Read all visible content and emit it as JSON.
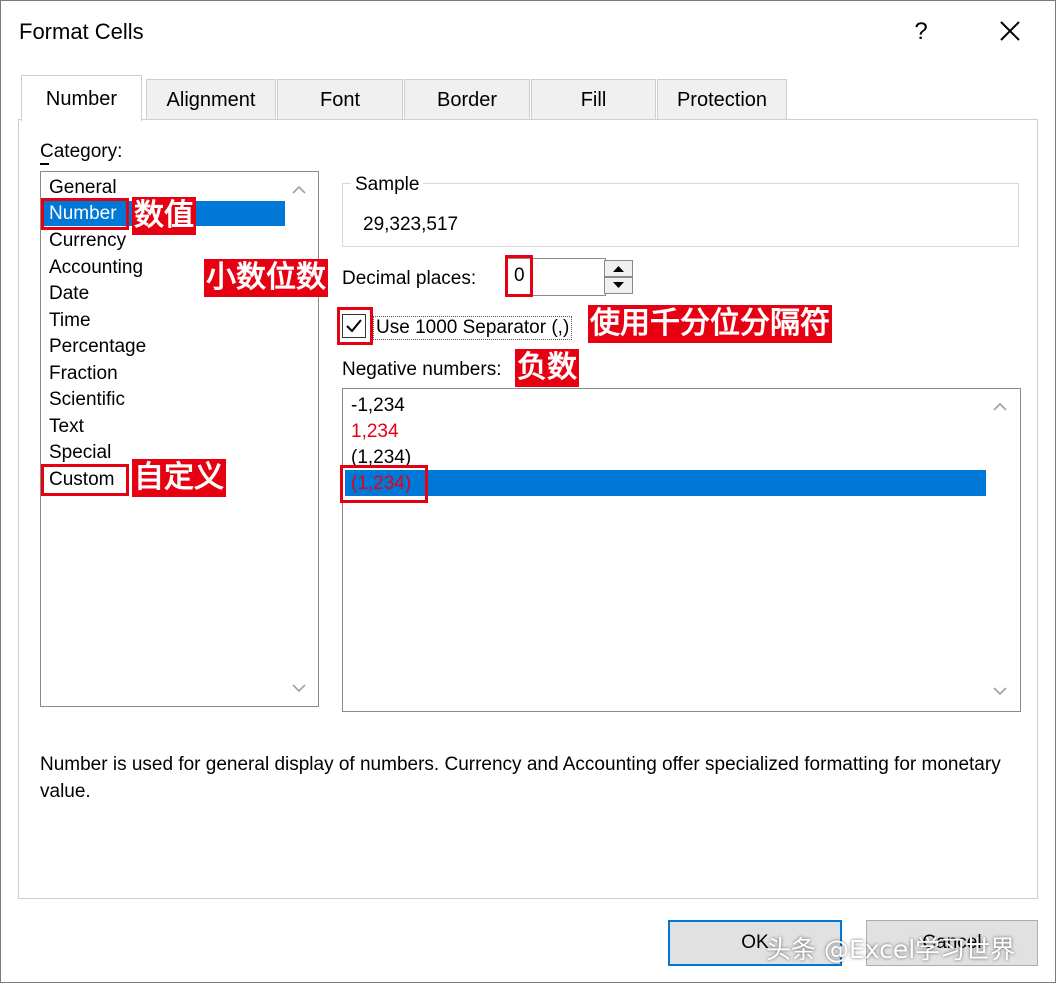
{
  "window": {
    "title": "Format Cells",
    "help_glyph": "?"
  },
  "tabs": [
    {
      "label": "Number",
      "active": true
    },
    {
      "label": "Alignment"
    },
    {
      "label": "Font"
    },
    {
      "label": "Border"
    },
    {
      "label": "Fill"
    },
    {
      "label": "Protection"
    }
  ],
  "category": {
    "label": "Category:",
    "items": [
      "General",
      "Number",
      "Currency",
      "Accounting",
      "Date",
      "Time",
      "Percentage",
      "Fraction",
      "Scientific",
      "Text",
      "Special",
      "Custom"
    ],
    "selected": "Number"
  },
  "sample": {
    "label": "Sample",
    "value": "29,323,517"
  },
  "decimal_places": {
    "label": "Decimal places:",
    "value": "0"
  },
  "separator": {
    "label": "Use 1000 Separator (,)",
    "checked": true
  },
  "negative_numbers": {
    "label": "Negative numbers:",
    "items": [
      {
        "text": "-1,234",
        "color": "#000000"
      },
      {
        "text": "1,234",
        "color": "#e60012"
      },
      {
        "text": "(1,234)",
        "color": "#000000"
      },
      {
        "text": "(1,234)",
        "color": "#e60012",
        "selected": true
      }
    ]
  },
  "description": "Number is used for general display of numbers.  Currency and Accounting offer specialized formatting for monetary value.",
  "buttons": {
    "ok": "OK",
    "cancel": "Cancel"
  },
  "annotations": {
    "number": "数值",
    "decimal": "小数位数",
    "separator": "使用千分位分隔符",
    "negative": "负数",
    "custom": "自定义"
  },
  "watermark": "头条 @Excel学习世界",
  "colors": {
    "selection": "#0078d7",
    "annotation": "#e60012"
  }
}
